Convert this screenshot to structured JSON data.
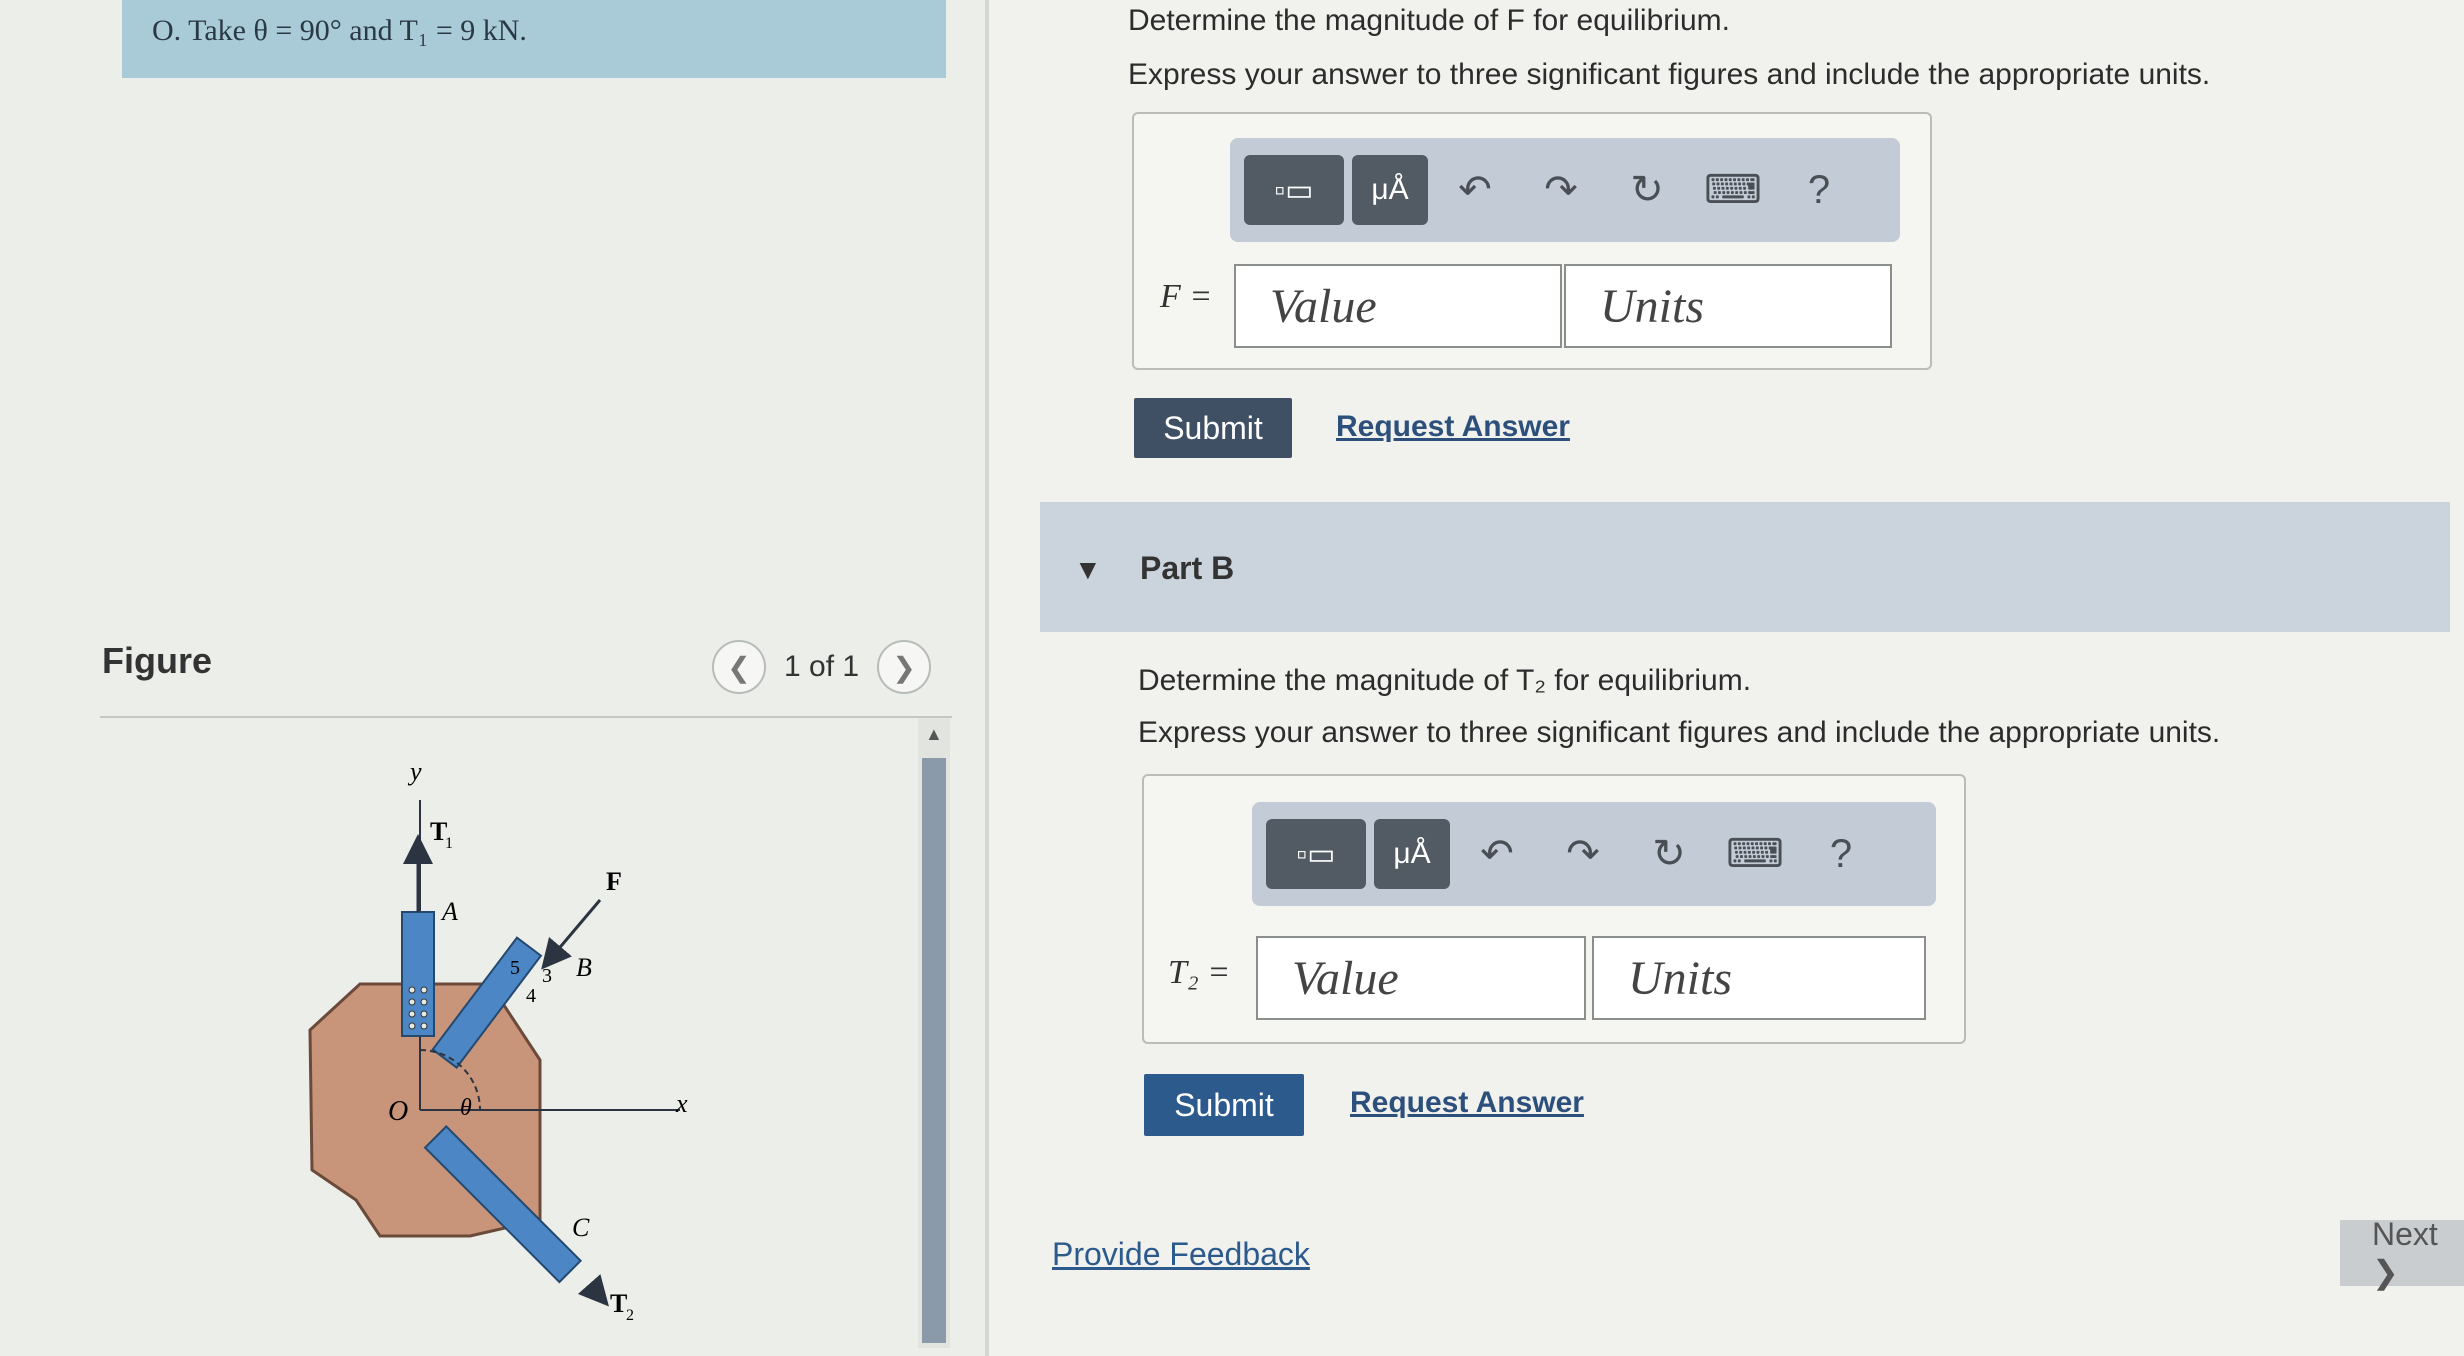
{
  "problem": {
    "text": "O. Take θ = 90° and T₁ = 9 kN."
  },
  "figure": {
    "label": "Figure",
    "pager": {
      "text": "1 of 1",
      "prev_icon": "chevron-left-icon",
      "next_icon": "chevron-right-icon"
    },
    "labels": {
      "y": "y",
      "x": "x",
      "t1": "T",
      "t1_sub": "1",
      "a": "A",
      "f": "F",
      "b": "B",
      "c": "C",
      "t2": "T",
      "t2_sub": "2",
      "o": "O",
      "theta": "θ",
      "r5": "5",
      "r3": "3",
      "r4": "4"
    }
  },
  "part_a": {
    "question": "Determine the magnitude of F for equilibrium.",
    "instructions": "Express your answer to three significant figures and include the appropriate units.",
    "variable": "F =",
    "value_placeholder": "Value",
    "units_placeholder": "Units",
    "submit_label": "Submit",
    "request_label": "Request Answer"
  },
  "part_b": {
    "header": "Part B",
    "question": "Determine the magnitude of T₂ for equilibrium.",
    "instructions": "Express your answer to three significant figures and include the appropriate units.",
    "variable": "T₂ =",
    "value_placeholder": "Value",
    "units_placeholder": "Units",
    "submit_label": "Submit",
    "request_label": "Request Answer"
  },
  "toolbar": {
    "units_glyph": "μÅ",
    "help_glyph": "?"
  },
  "footer": {
    "feedback_label": "Provide Feedback",
    "next_label": "Next ❯"
  }
}
